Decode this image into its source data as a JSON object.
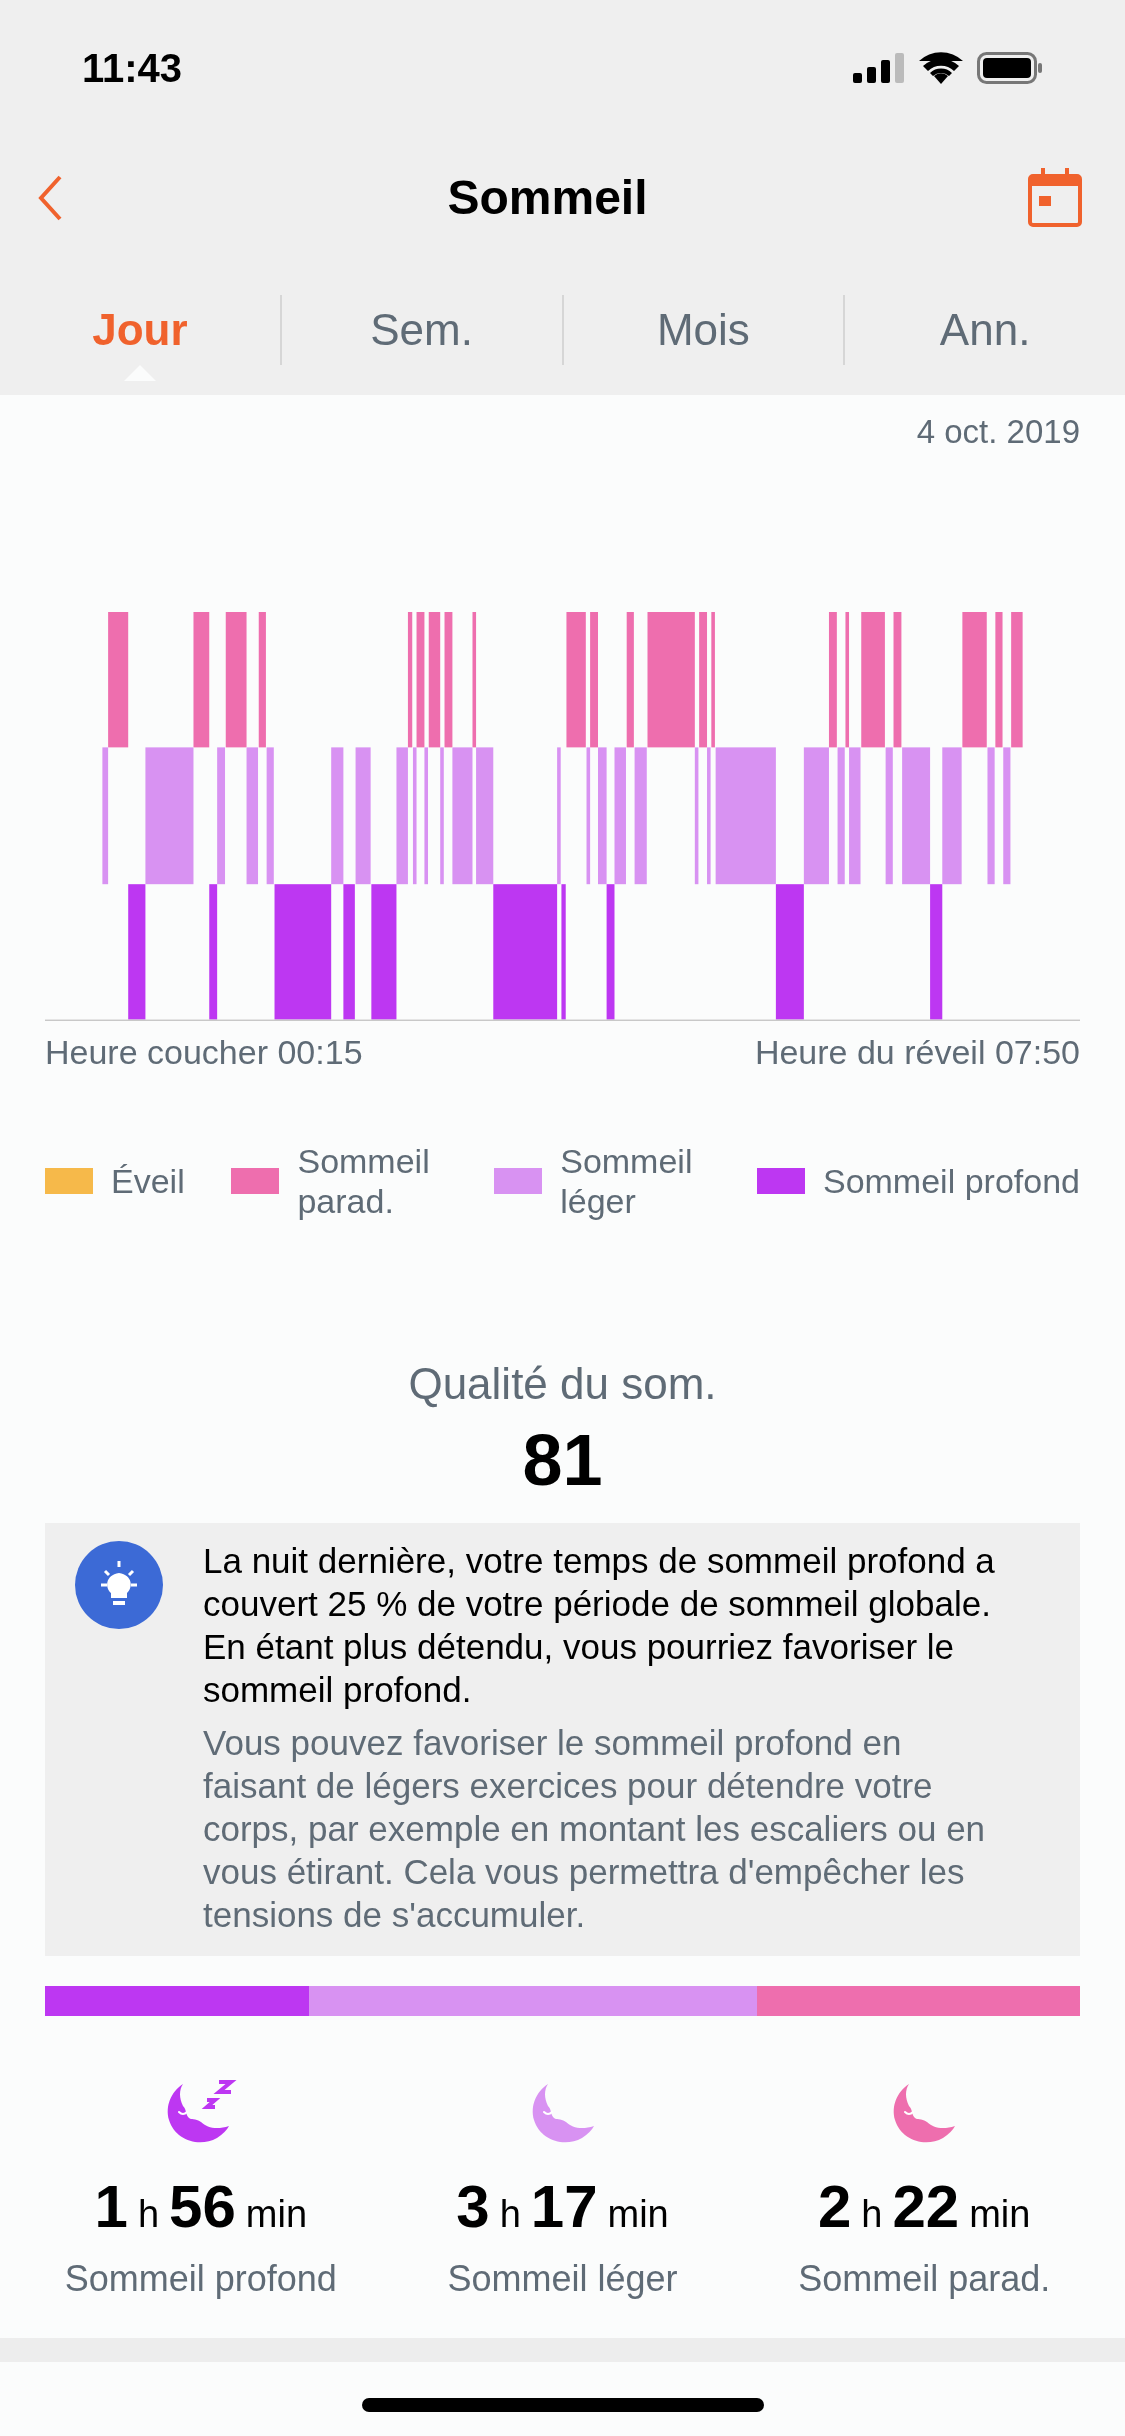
{
  "status_bar": {
    "time": "11:43"
  },
  "header": {
    "title": "Sommeil"
  },
  "tabs": [
    {
      "label": "Jour",
      "selected": true
    },
    {
      "label": "Sem.",
      "selected": false
    },
    {
      "label": "Mois",
      "selected": false
    },
    {
      "label": "Ann.",
      "selected": false
    }
  ],
  "date": "4 oct. 2019",
  "chart_labels": {
    "bedtime": "Heure coucher 00:15",
    "wake": "Heure du réveil 07:50"
  },
  "legend": [
    {
      "label": "Éveil",
      "color": "#f6b94a"
    },
    {
      "label": "Sommeil parad.",
      "color": "#ee6eae"
    },
    {
      "label": "Sommeil léger",
      "color": "#d892f2"
    },
    {
      "label": "Sommeil profond",
      "color": "#bd37f2"
    }
  ],
  "quality": {
    "label": "Qualité du som.",
    "score": "81"
  },
  "tip": {
    "text": "La nuit dernière, votre temps de sommeil profond a couvert 25 % de votre période de sommeil globale. En étant plus détendu, vous pourriez favoriser le sommeil profond.",
    "advice": "Vous pouvez favoriser le sommeil profond en faisant de légers exercices pour détendre votre corps, par exemple en montant les escaliers ou en vous étirant. Cela vous permettra d'empêcher les tensions de s'accumuler."
  },
  "summary": [
    {
      "kind": "deep",
      "color": "#bd37f2",
      "hours": "1",
      "hours_unit": "h",
      "minutes": "56",
      "minutes_unit": "min",
      "label": "Sommeil profond"
    },
    {
      "kind": "light",
      "color": "#d892f2",
      "hours": "3",
      "hours_unit": "h",
      "minutes": "17",
      "minutes_unit": "min",
      "label": "Sommeil léger"
    },
    {
      "kind": "rem",
      "color": "#ee6eae",
      "hours": "2",
      "hours_unit": "h",
      "minutes": "22",
      "minutes_unit": "min",
      "label": "Sommeil parad."
    }
  ]
}
